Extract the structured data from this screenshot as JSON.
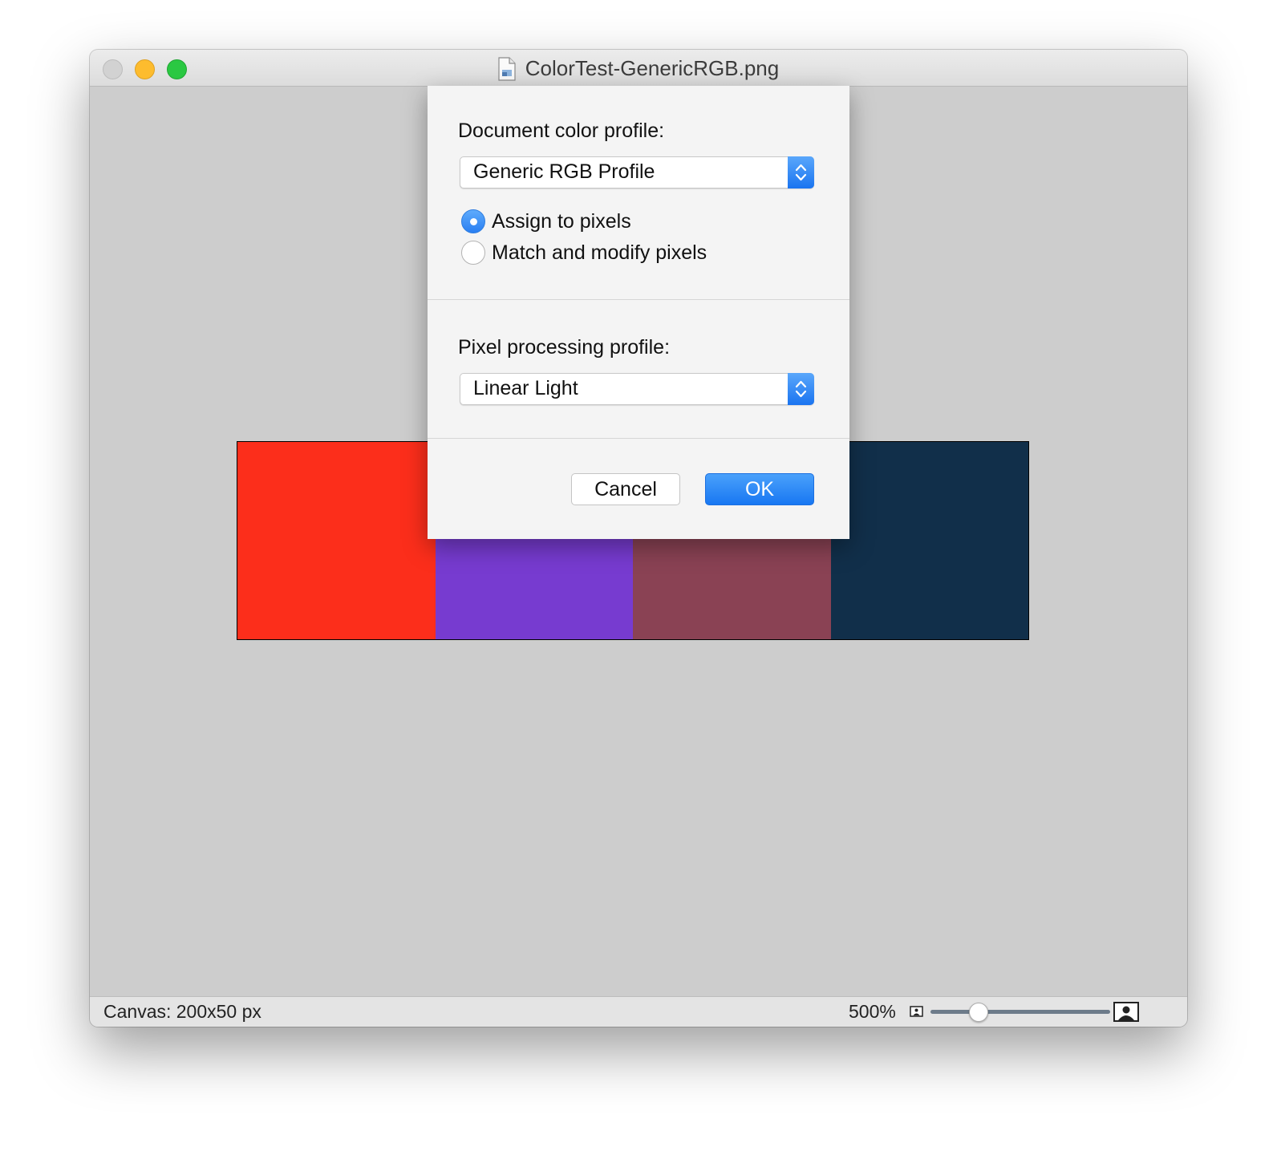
{
  "window": {
    "title": "ColorTest-GenericRGB.png",
    "icon": "document-icon"
  },
  "canvas": {
    "swatches": [
      {
        "color": "#fc2e1b"
      },
      {
        "color": "#773bd0"
      },
      {
        "color": "#8a4254"
      },
      {
        "color": "#112f4a"
      }
    ]
  },
  "dialog": {
    "document_profile": {
      "label": "Document color profile:",
      "selected": "Generic RGB Profile",
      "options": [
        {
          "label": "Assign to pixels",
          "checked": true
        },
        {
          "label": "Match and modify pixels",
          "checked": false
        }
      ]
    },
    "pixel_profile": {
      "label": "Pixel processing profile:",
      "selected": "Linear Light"
    },
    "cancel_label": "Cancel",
    "ok_label": "OK"
  },
  "statusbar": {
    "canvas_info": "Canvas: 200x50 px",
    "zoom_label": "500%",
    "zoom_slider_value": 0.27
  }
}
